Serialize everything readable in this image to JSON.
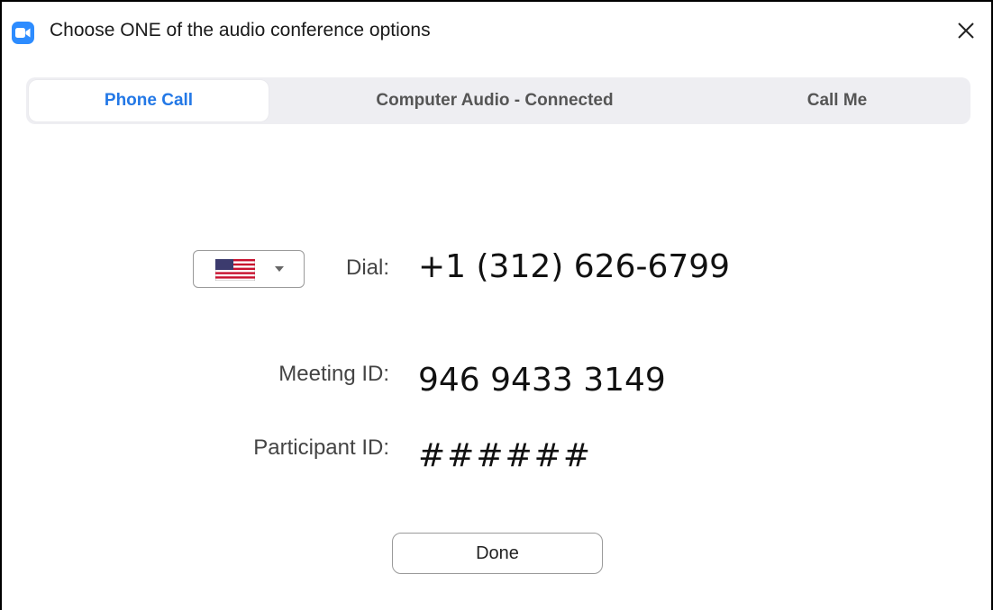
{
  "window": {
    "title": "Choose ONE of the audio conference options",
    "app_icon": "zoom-camera-icon",
    "close_icon": "close-icon"
  },
  "tabs": [
    {
      "label": "Phone Call",
      "active": true
    },
    {
      "label": "Computer Audio - Connected",
      "active": false
    },
    {
      "label": "Call Me",
      "active": false
    }
  ],
  "dial": {
    "country_icon": "us-flag-icon",
    "label": "Dial:",
    "number": "+1 (312) 626-6799"
  },
  "meeting": {
    "label": "Meeting ID:",
    "id": "946 9433 3149"
  },
  "participant": {
    "label": "Participant ID:",
    "id": "######"
  },
  "done_label": "Done",
  "colors": {
    "accent": "#2378E6",
    "app_icon": "#2D8CFF",
    "tab_bar": "#EEEEF2"
  }
}
